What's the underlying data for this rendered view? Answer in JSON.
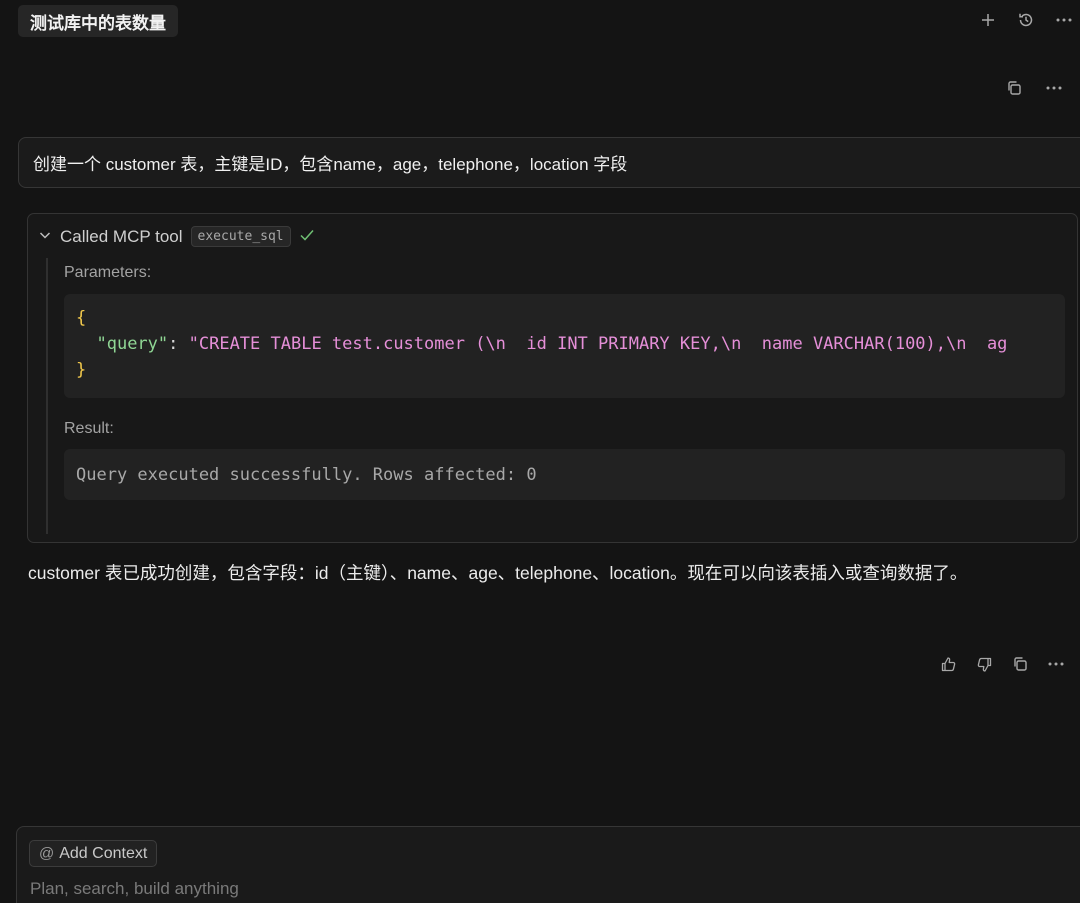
{
  "header": {
    "title": "测试库中的表数量",
    "icons": [
      "plus-icon",
      "history-icon",
      "more-icon"
    ]
  },
  "user_message": {
    "text": "创建一个 customer 表，主键是ID，包含name，age，telephone，location 字段",
    "action_icons": [
      "copy-icon",
      "more-icon"
    ]
  },
  "tool_call": {
    "label": "Called MCP tool",
    "tool_name": "execute_sql",
    "status_icon": "check-icon",
    "parameters_label": "Parameters:",
    "code": {
      "open": "{",
      "key": "\"query\"",
      "colon": ": ",
      "value": "\"CREATE TABLE test.customer (\\n  id INT PRIMARY KEY,\\n  name VARCHAR(100),\\n  ag",
      "close": "}"
    },
    "result_label": "Result:",
    "result_text": "Query executed successfully. Rows affected: 0"
  },
  "reply": {
    "text": "customer 表已成功创建，包含字段：id（主键）、name、age、telephone、location。现在可以向该表插入或查询数据了。",
    "action_icons": [
      "thumbs-up-icon",
      "thumbs-down-icon",
      "copy-icon",
      "more-icon"
    ]
  },
  "composer": {
    "context_label": "Add Context",
    "context_prefix": "@",
    "placeholder": "Plan, search, build anything"
  },
  "colors": {
    "background": "#141414",
    "string": "#e58fd8",
    "key": "#8fd694",
    "brace": "#f2c94c",
    "check": "#6fbf73"
  }
}
